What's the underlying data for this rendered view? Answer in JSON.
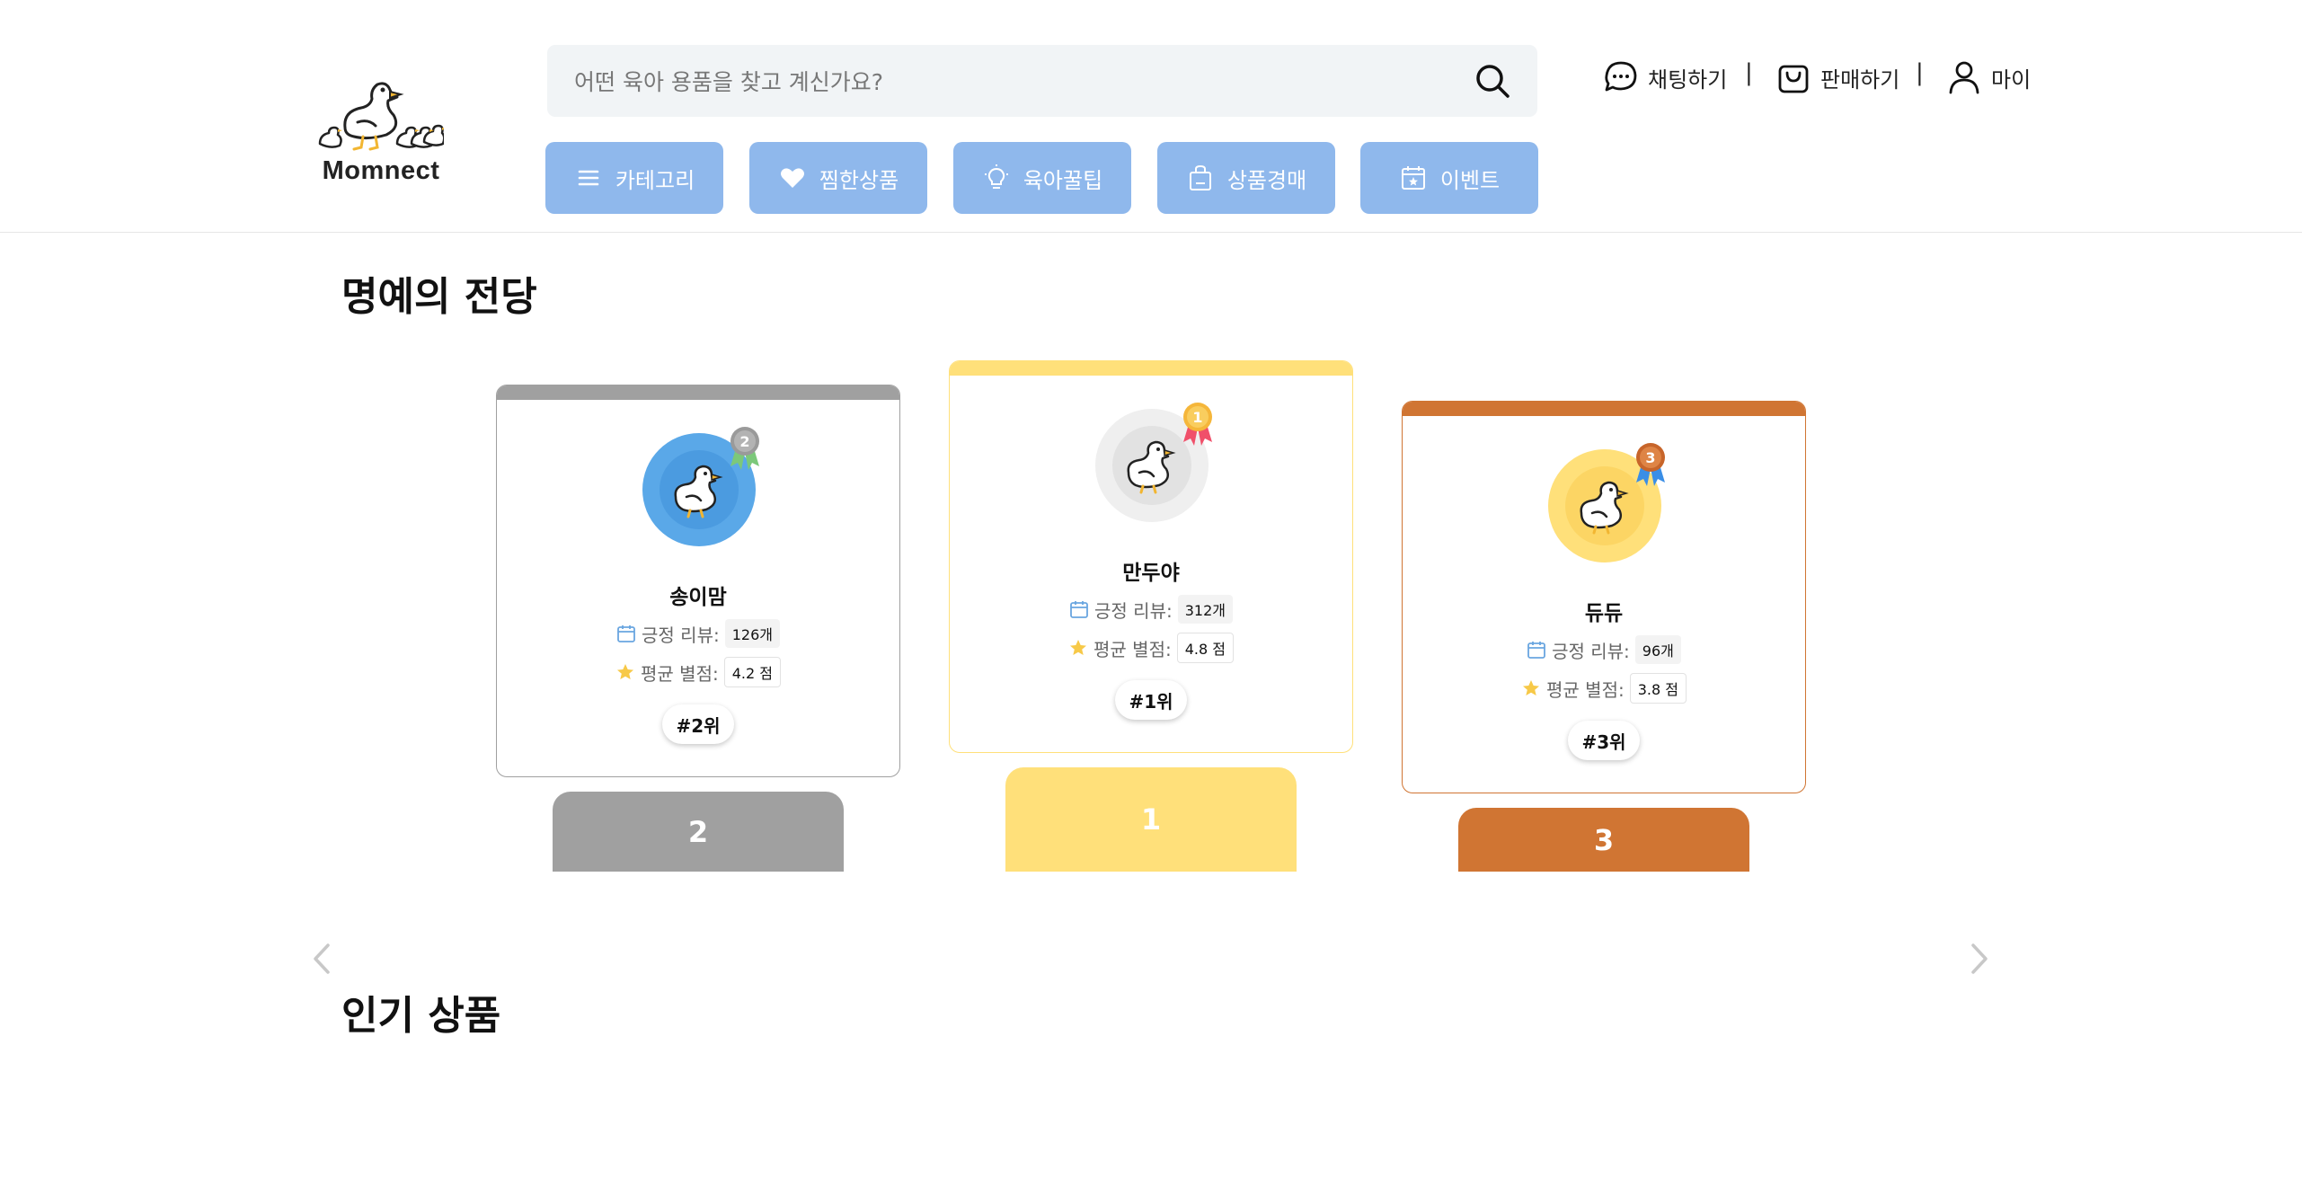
{
  "logo": {
    "text": "Momnect"
  },
  "search": {
    "placeholder": "어떤 육아 용품을 찾고 계신가요?"
  },
  "nav": [
    {
      "label": "카테고리",
      "icon": "menu-icon"
    },
    {
      "label": "찜한상품",
      "icon": "heart-icon"
    },
    {
      "label": "육아꿀팁",
      "icon": "lightbulb-icon"
    },
    {
      "label": "상품경매",
      "icon": "auction-bag-icon"
    },
    {
      "label": "이벤트",
      "icon": "calendar-star-icon"
    }
  ],
  "util": {
    "chat": "채팅하기",
    "sell": "판매하기",
    "my": "마이",
    "separator": "|"
  },
  "hall_of_fame": {
    "title": "명예의 전당",
    "review_label": "긍정 리뷰:",
    "rating_label": "평균 별점:",
    "ranks": [
      {
        "rank": "2",
        "name": "송이맘",
        "reviews": "126개",
        "rating": "4.2 점",
        "rank_label": "#2위",
        "color": "#a0a0a0",
        "avatar_color": "#5aa8e8",
        "podium": "2"
      },
      {
        "rank": "1",
        "name": "만두야",
        "reviews": "312개",
        "rating": "4.8 점",
        "rank_label": "#1위",
        "color": "#ffe07a",
        "avatar_color": "#efefef",
        "podium": "1"
      },
      {
        "rank": "3",
        "name": "듀듀",
        "reviews": "96개",
        "rating": "3.8 점",
        "rank_label": "#3위",
        "color": "#d07533",
        "avatar_color": "#ffe07a",
        "podium": "3"
      }
    ]
  },
  "popular": {
    "title": "인기 상품"
  }
}
